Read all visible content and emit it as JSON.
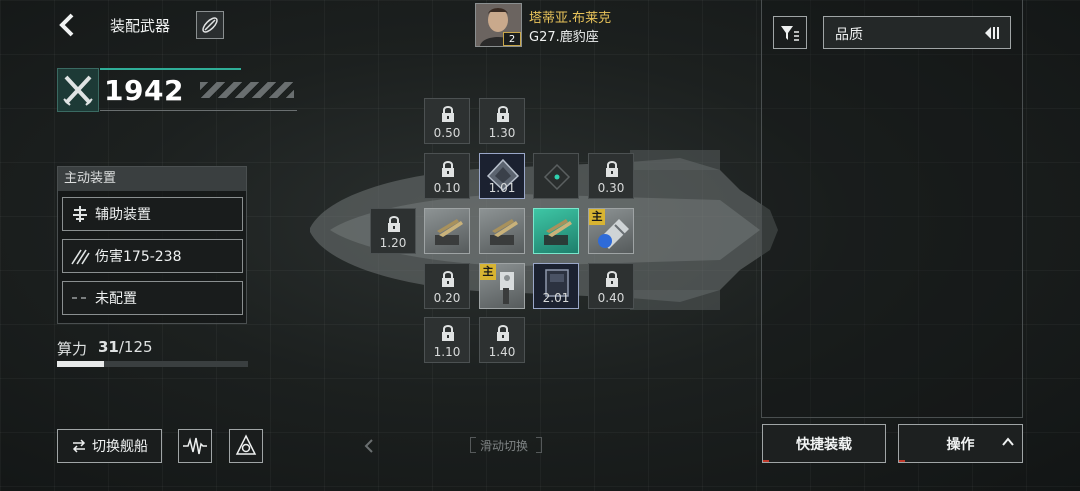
{
  "header": {
    "title": "装配武器"
  },
  "power": {
    "value": "1942"
  },
  "active_panel": {
    "header": "主动装置",
    "rows": [
      {
        "label": "辅助装置",
        "icon": "auxiliary-device-icon"
      },
      {
        "label": "伤害175-238",
        "icon": "damage-claw-icon"
      },
      {
        "label": "未配置",
        "icon": "dash-icon"
      }
    ]
  },
  "compute": {
    "label": "算力",
    "used": "31",
    "total": "/125",
    "fraction": 0.248
  },
  "bottom_left": {
    "switch_ship": "切换舰船"
  },
  "character": {
    "name": "塔蒂亚.布莱克",
    "ship": "G27.鹿豹座",
    "level": "2"
  },
  "slots": {
    "r1c1": "0.50",
    "r1c2": "1.30",
    "r2c1": "0.10",
    "r2c2": "1.01",
    "r2c4": "0.30",
    "r3c0": "1.20",
    "main_tag": "主",
    "r4c1": "0.20",
    "r4c3": "2.01",
    "r4c4": "0.40",
    "r5c1": "1.10",
    "r5c2": "1.40"
  },
  "slide": {
    "text": "滑动切换"
  },
  "right": {
    "quality_label": "品质",
    "quick_equip": "快捷装载",
    "operate": "操作"
  },
  "colors": {
    "accent": "#2fae98",
    "main_tag": "#d8b432",
    "name": "#e8c35a"
  }
}
